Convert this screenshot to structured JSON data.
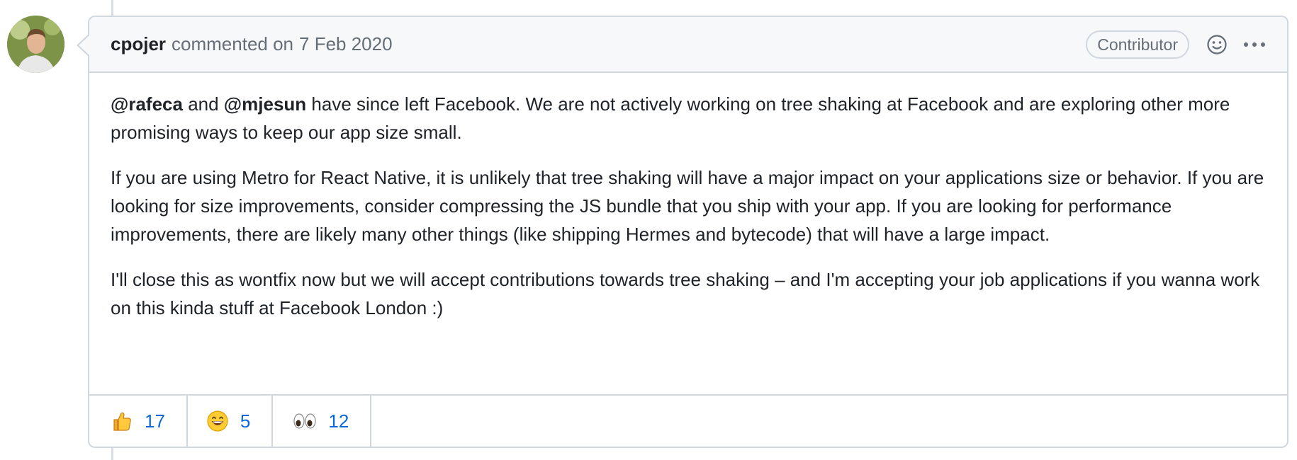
{
  "comment": {
    "author": "cpojer",
    "action": "commented on",
    "date": "7 Feb 2020",
    "badge": "Contributor",
    "smiley_icon": "smiley-icon",
    "menu_icon": "kebab-horizontal-icon",
    "paragraphs": {
      "p1": {
        "mention1": "@rafeca",
        "t1": " and ",
        "mention2": "@mjesun",
        "t2": " have since left Facebook. We are not actively working on tree shaking at Facebook and are exploring other more promising ways to keep our app size small."
      },
      "p2": "If you are using Metro for React Native, it is unlikely that tree shaking will have a major impact on your applications size or behavior. If you are looking for size improvements, consider compressing the JS bundle that you ship with your app. If you are looking for performance improvements, there are likely many other things (like shipping Hermes and bytecode) that will have a large impact.",
      "p3": "I'll close this as wontfix now but we will accept contributions towards tree shaking – and I'm accepting your job applications if you wanna work on this kinda stuff at Facebook London :)"
    }
  },
  "reactions": [
    {
      "icon": "thumbs-up-icon",
      "count": "17"
    },
    {
      "icon": "grinning-face-icon",
      "count": "5"
    },
    {
      "icon": "eyes-icon",
      "count": "12"
    }
  ],
  "colors": {
    "link": "#0969da",
    "border": "#d0d7de",
    "header_bg": "#f6f8fa",
    "muted": "#656d76"
  }
}
